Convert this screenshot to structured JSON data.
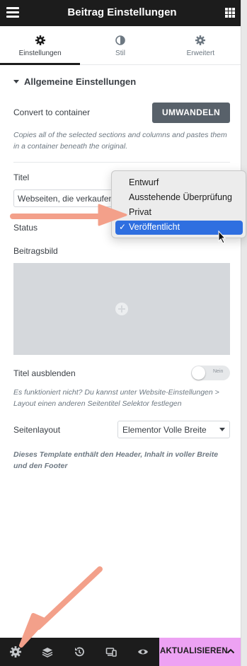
{
  "header": {
    "title": "Beitrag Einstellungen",
    "menu_icon": "hamburger-icon",
    "apps_icon": "grid-icon"
  },
  "tabs": [
    {
      "label": "Einstellungen",
      "icon": "gear-icon",
      "active": true
    },
    {
      "label": "Stil",
      "icon": "half-circle-icon",
      "active": false
    },
    {
      "label": "Erweitert",
      "icon": "gear-icon",
      "active": false
    }
  ],
  "section": {
    "title": "Allgemeine Einstellungen"
  },
  "convert": {
    "label": "Convert to container",
    "button_label": "UMWANDELN",
    "hint": "Copies all of the selected sections and columns and pastes them in a container beneath the original."
  },
  "title_field": {
    "label": "Titel",
    "value": "Webseiten, die verkaufen"
  },
  "status_field": {
    "label": "Status"
  },
  "status_dropdown": {
    "options": [
      "Entwurf",
      "Ausstehende Überprüfung",
      "Privat",
      "Veröffentlicht"
    ],
    "selected": "Veröffentlicht",
    "check": "✓"
  },
  "featured_image": {
    "label": "Beitragsbild"
  },
  "hide_title": {
    "label": "Titel ausblenden",
    "switch_text": "Nein",
    "hint": "Es funktioniert nicht? Du kannst unter Website-Einstellungen > Layout einen anderen Seitentitel Selektor festlegen"
  },
  "page_layout": {
    "label": "Seitenlayout",
    "value": "Elementor Volle Breite",
    "hint": "Dieses Template enthält den Header, Inhalt in voller Breite und den Footer"
  },
  "footer": {
    "icons": [
      "settings-icon",
      "layers-icon",
      "history-icon",
      "responsive-icon",
      "preview-icon"
    ],
    "update_label": "AKTUALISIEREN"
  },
  "colors": {
    "header_bg": "#1c1c1c",
    "button_dark": "#58616a",
    "update_bg": "#eda2f3",
    "selection": "#2f6fe0",
    "annotation_arrow": "#f3a08a"
  }
}
